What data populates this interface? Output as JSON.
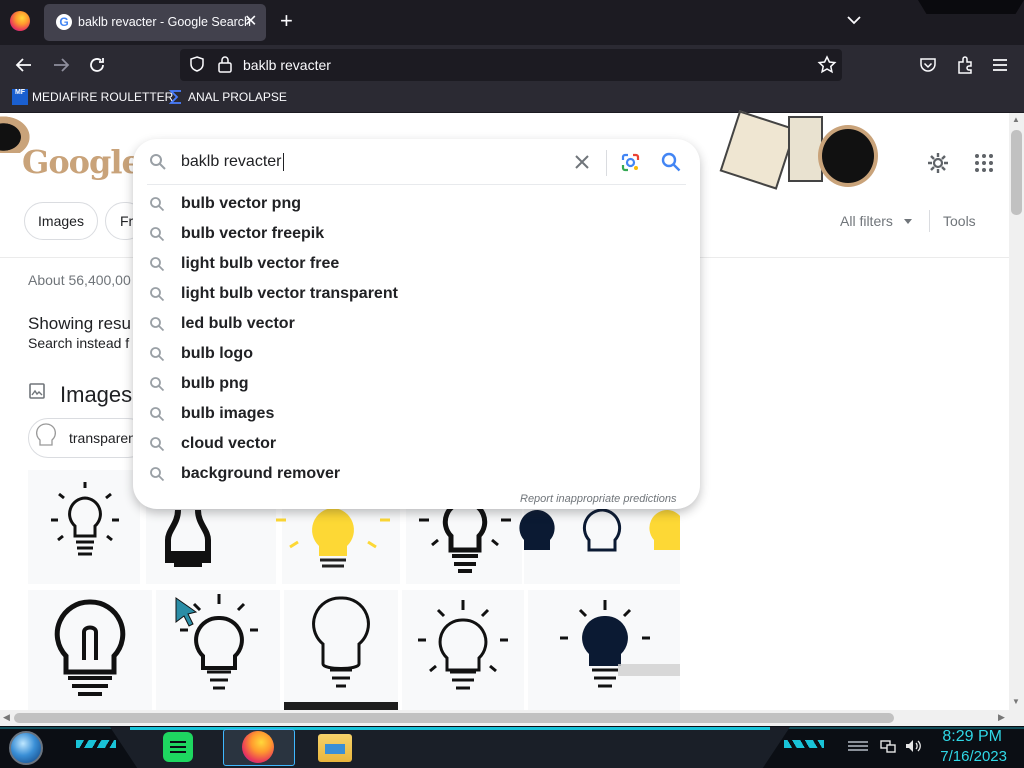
{
  "browser": {
    "tab_title": "baklb revacter - Google Search",
    "tab_favicon": "G",
    "url": "baklb revacter",
    "bookmarks": [
      {
        "label": "MEDIAFIRE ROULETTER",
        "icon": "MF"
      },
      {
        "label": "ANAL PROLAPSE",
        "icon": "sigma-icon"
      }
    ]
  },
  "google": {
    "logo_text": "Google",
    "search_value": "baklb revacter",
    "chips": [
      "Images",
      "Fr"
    ],
    "all_filters": "All filters",
    "tools": "Tools",
    "results_count": "About 56,400,00",
    "showing_results": "Showing resu",
    "search_instead": "Search instead f",
    "images_heading": "Images",
    "image_chip": "transparen",
    "report_text": "Report inappropriate predictions",
    "suggestions": [
      "bulb vector png",
      "bulb vector freepik",
      "light bulb vector free",
      "light bulb vector transparent",
      "led bulb vector",
      "bulb logo",
      "bulb png",
      "bulb images",
      "cloud vector",
      "background remover"
    ]
  },
  "taskbar": {
    "time": "8:29 PM",
    "date": "7/16/2023"
  },
  "colors": {
    "chrome_dark": "#1c1b22",
    "chrome_mid": "#2b2a33",
    "google_blue": "#4285f4",
    "taskbar_cyan": "#19c3d8"
  }
}
